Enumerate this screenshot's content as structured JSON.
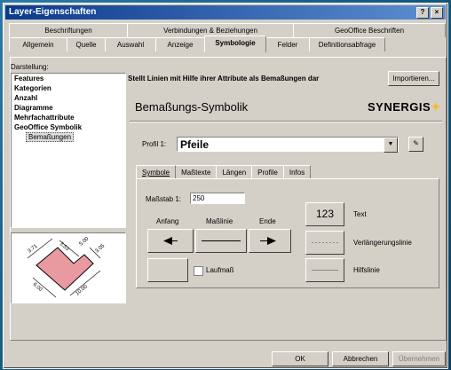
{
  "window": {
    "title": "Layer-Eigenschaften",
    "help_btn": "?",
    "close_btn": "×"
  },
  "tabs_row1": [
    "Beschriftungen",
    "Verbindungen & Beziehungen",
    "GeoOffice Beschriften"
  ],
  "tabs_row2": [
    "Allgemein",
    "Quelle",
    "Auswahl",
    "Anzeige",
    "Symbologie",
    "Felder",
    "Definitionsabfrage"
  ],
  "tabs_row2_active": "Symbologie",
  "sidebar": {
    "label": "Darstellung:",
    "items": [
      "Features",
      "Kategorien",
      "Anzahl",
      "Diagramme",
      "Mehrfachattribute",
      "GeoOffice Symbolik"
    ],
    "child": "Bemaßungen"
  },
  "main": {
    "description": "Stellt Linien mit Hilfe ihrer Attribute als Bemaßungen dar",
    "import_button": "Importieren...",
    "title": "Bemaßungs-Symbolik",
    "brand": "SYNERGIS",
    "profile_label": "Profil 1:",
    "profile_value": "Pfeile",
    "subtabs": [
      "Symbole",
      "Maßtexte",
      "Längen",
      "Profile",
      "Infos"
    ],
    "scale_label": "Maßstab 1:",
    "scale_value": "250",
    "col_start": "Anfang",
    "col_line": "Maßlinie",
    "col_end": "Ende",
    "text_sample": "123",
    "text_label": "Text",
    "ext_label": "Verlängerungslinie",
    "help_label": "Hilfslinie",
    "laufmass_label": "Laufmaß"
  },
  "preview_dims": [
    "3.71",
    "3.53",
    "5.00",
    "3.05",
    "6.00",
    "10.00"
  ],
  "footer": {
    "ok": "OK",
    "cancel": "Abbrechen",
    "apply": "Übernehmen"
  },
  "colors": {
    "titlebar": "#0b3a8c",
    "preview_fill": "#e89aa0",
    "brand_star": "#f0c020"
  }
}
